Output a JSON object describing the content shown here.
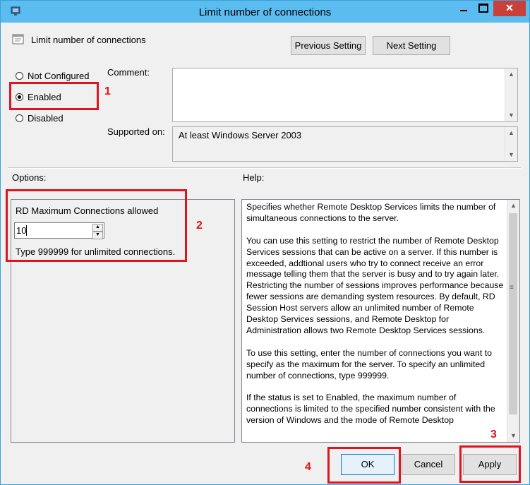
{
  "window": {
    "title": "Limit number of connections"
  },
  "header": {
    "setting_name": "Limit number of connections",
    "prev_label": "Previous Setting",
    "next_label": "Next Setting"
  },
  "state": {
    "options": [
      {
        "label": "Not Configured",
        "selected": false
      },
      {
        "label": "Enabled",
        "selected": true
      },
      {
        "label": "Disabled",
        "selected": false
      }
    ]
  },
  "comment": {
    "label": "Comment:",
    "value": ""
  },
  "supported": {
    "label": "Supported on:",
    "value": "At least Windows Server 2003"
  },
  "options_section": {
    "label": "Options:",
    "field_label": "RD Maximum Connections allowed",
    "field_value": "10",
    "hint": "Type 999999 for unlimited connections."
  },
  "help": {
    "label": "Help:",
    "paragraphs": [
      "Specifies whether Remote Desktop Services limits the number of simultaneous connections to the server.",
      "You can use this setting to restrict the number of Remote Desktop Services sessions that can be active on a server. If this number is exceeded, addtional users who try to connect receive an error message telling them that the server is busy and to try again later. Restricting the number of sessions improves performance because fewer sessions are demanding system resources. By default, RD Session Host servers allow an unlimited number of Remote Desktop Services sessions, and Remote Desktop for Administration allows two Remote Desktop Services sessions.",
      "To use this setting, enter the number of connections you want to specify as the maximum for the server. To specify an unlimited number of connections, type 999999.",
      "If the status is set to Enabled, the maximum number of connections is limited to the specified number consistent with the version of Windows and the mode of Remote Desktop"
    ]
  },
  "footer": {
    "ok_label": "OK",
    "cancel_label": "Cancel",
    "apply_label": "Apply"
  },
  "annotations": {
    "n1": "1",
    "n2": "2",
    "n3": "3",
    "n4": "4",
    "color": "#e0141e"
  },
  "icons": {
    "app": "group-policy-icon",
    "setting": "policy-setting-icon"
  }
}
